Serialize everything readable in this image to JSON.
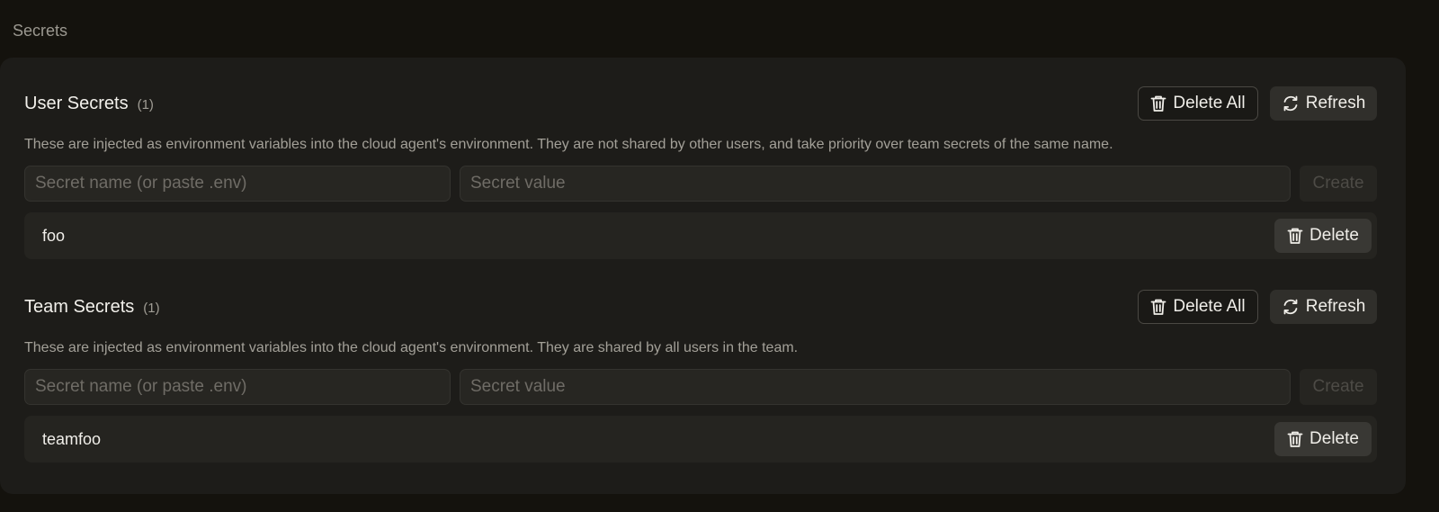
{
  "page": {
    "heading": "Secrets"
  },
  "user_secrets": {
    "title": "User Secrets",
    "count": "(1)",
    "delete_all_label": "Delete All",
    "refresh_label": "Refresh",
    "description": "These are injected as environment variables into the cloud agent's environment. They are not shared by other users, and take priority over team secrets of the same name.",
    "name_placeholder": "Secret name (or paste .env)",
    "value_placeholder": "Secret value",
    "create_label": "Create",
    "items": [
      {
        "name": "foo",
        "delete_label": "Delete"
      }
    ]
  },
  "team_secrets": {
    "title": "Team Secrets",
    "count": "(1)",
    "delete_all_label": "Delete All",
    "refresh_label": "Refresh",
    "description": "These are injected as environment variables into the cloud agent's environment. They are shared by all users in the team.",
    "name_placeholder": "Secret name (or paste .env)",
    "value_placeholder": "Secret value",
    "create_label": "Create",
    "items": [
      {
        "name": "teamfoo",
        "delete_label": "Delete"
      }
    ]
  },
  "icons": {
    "trash": "trash-icon",
    "refresh": "refresh-icon"
  },
  "colors": {
    "background": "#14120d",
    "panel": "#1d1c19",
    "row": "#252420",
    "text": "#f0eee9",
    "muted_text": "#a3a098"
  }
}
